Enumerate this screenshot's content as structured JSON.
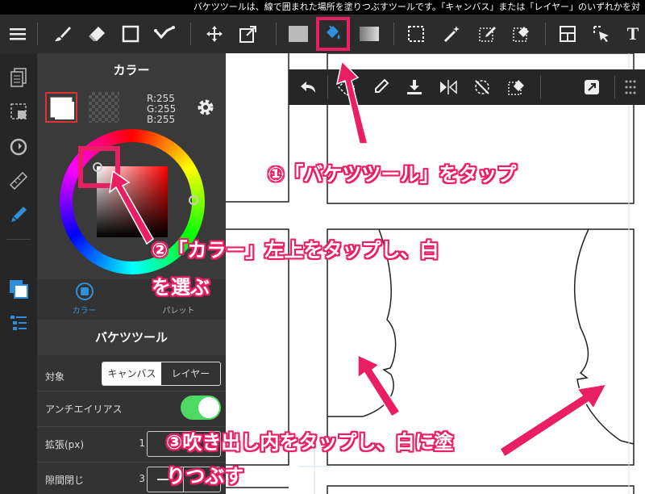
{
  "status_bar": {
    "text": "バケツツールは、線で囲まれた場所を塗りつぶすツールです。「キャンバス」または「レイヤー」のいずれかを対"
  },
  "toolbar": {
    "icons": [
      "menu-icon",
      "brush-icon",
      "eraser-icon",
      "square-select-icon",
      "check-icon",
      "move-icon",
      "transform-icon",
      "fill-color-icon",
      "bucket-icon",
      "gradient-icon",
      "select-rect-icon",
      "magic-wand-icon",
      "select-pen-icon",
      "select-eraser-icon",
      "layout-icon",
      "select-cursor-icon",
      "text-icon"
    ]
  },
  "color_panel": {
    "title": "カラー",
    "rgb_r": "R:255",
    "rgb_g": "G:255",
    "rgb_b": "B:255",
    "tab_color": "カラー",
    "tab_palette": "パレット"
  },
  "bucket_panel": {
    "title": "バケツツール",
    "target_label": "対象",
    "target_opt1": "キャンバス",
    "target_opt2": "レイヤー",
    "antialias_label": "アンチエイリアス",
    "expand_label": "拡張(px)",
    "expand_value": "1",
    "gap_label": "隙間閉じ",
    "gap_value": "3"
  },
  "annotations": {
    "step1": "①「バケツツール」をタップ",
    "step2_line1": "②「カラー」左上をタップし、白",
    "step2_line2": "を選ぶ",
    "step3_line1": "③吹き出し内をタップし、白に塗",
    "step3_line2": "りつぶす"
  },
  "colors": {
    "accent": "#e91e63",
    "toggle_on": "#4cd964",
    "active_blue": "#2f8fdb"
  }
}
